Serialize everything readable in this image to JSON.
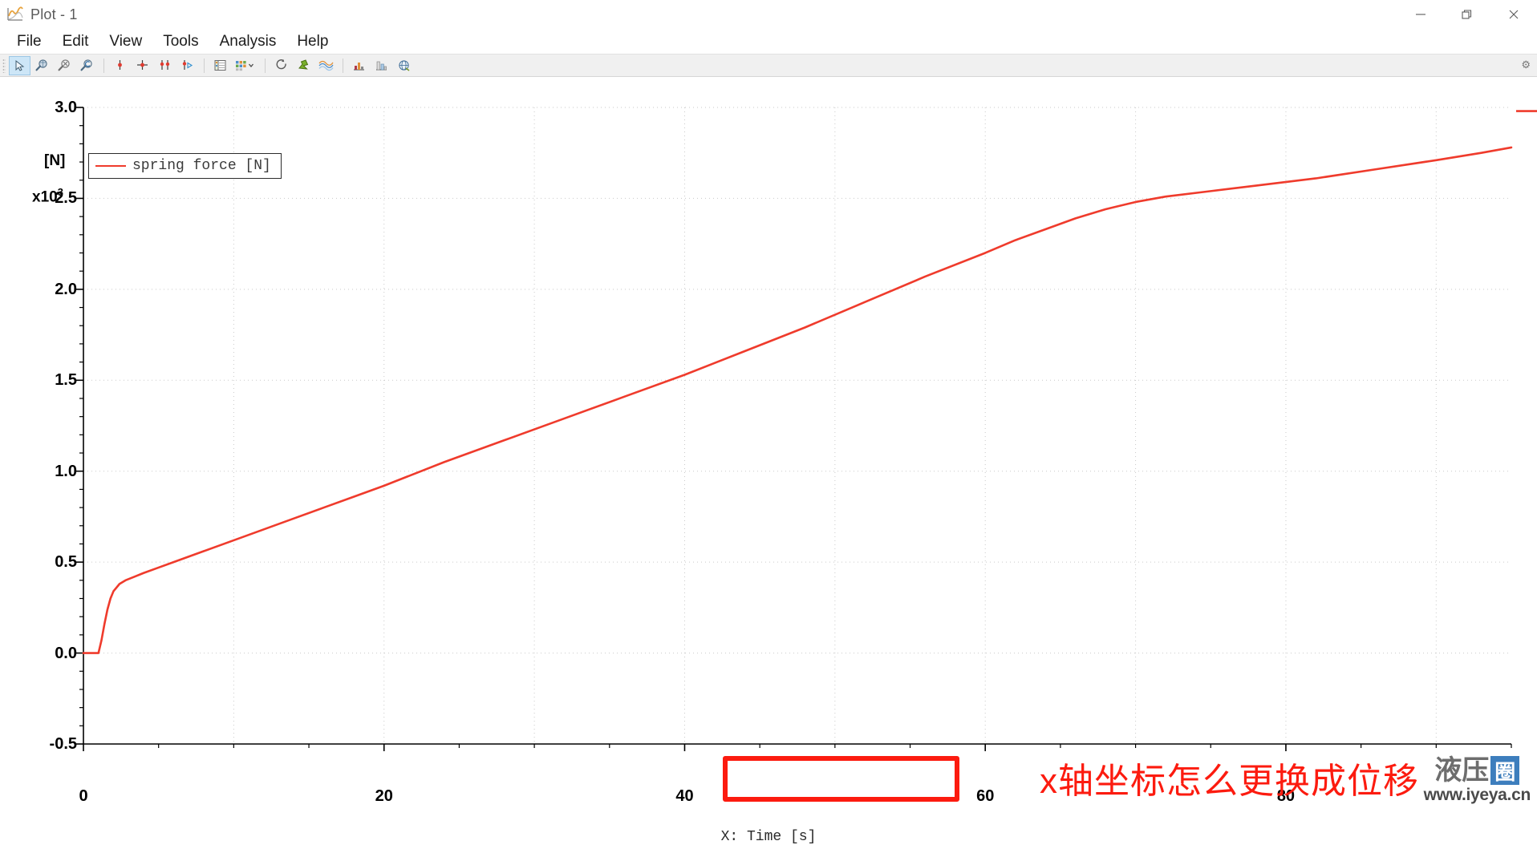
{
  "window": {
    "title": "Plot - 1",
    "app_icon": "plot-chart-icon",
    "minimize_label": "—",
    "maximize_label": "❐",
    "close_label": "✕"
  },
  "menu": {
    "items": [
      {
        "label": "File"
      },
      {
        "label": "Edit"
      },
      {
        "label": "View"
      },
      {
        "label": "Tools"
      },
      {
        "label": "Analysis"
      },
      {
        "label": "Help"
      }
    ]
  },
  "toolbar": {
    "buttons": [
      {
        "name": "select-arrow-tool",
        "icon": "cursor-arrow-icon",
        "active": true
      },
      {
        "name": "zoom-window-tool",
        "icon": "magnifier-window-icon",
        "active": false
      },
      {
        "name": "zoom-out-tool",
        "icon": "magnifier-minus-icon",
        "active": false
      },
      {
        "name": "zoom-previous-tool",
        "icon": "magnifier-undo-icon",
        "active": false
      },
      {
        "name": "single-cursor-tool",
        "icon": "pin-single-icon",
        "active": false
      },
      {
        "name": "cross-cursor-tool",
        "icon": "pin-cross-icon",
        "active": false
      },
      {
        "name": "dual-cursor-tool",
        "icon": "pin-double-icon",
        "active": false
      },
      {
        "name": "cursor-play-tool",
        "icon": "pin-play-icon",
        "active": false
      },
      {
        "name": "data-table-tool",
        "icon": "table-list-icon",
        "active": false
      },
      {
        "name": "grid-layout-tool",
        "icon": "grid-squares-icon",
        "active": false
      },
      {
        "name": "refresh-tool",
        "icon": "refresh-circle-icon",
        "active": false
      },
      {
        "name": "pin-plot-tool",
        "icon": "pushpin-star-icon",
        "active": false
      },
      {
        "name": "curves-tool",
        "icon": "wave-curves-icon",
        "active": false
      },
      {
        "name": "histogram-tool",
        "icon": "bar-chart-icon",
        "active": false
      },
      {
        "name": "statistics-tool",
        "icon": "column-chart-icon",
        "active": false
      },
      {
        "name": "export-tool",
        "icon": "globe-export-icon",
        "active": false
      }
    ],
    "overflow_icon": "chevron-down-icon",
    "right_icon": "settings-small-icon"
  },
  "annotations": {
    "red_text": "x轴坐标怎么更换成位移",
    "red_box_label": "",
    "red_color": "#fc1b0f"
  },
  "watermark": {
    "cn_text": "液压",
    "badge_text": "圈",
    "url": "www.iyeya.cn"
  },
  "chart_data": {
    "type": "line",
    "title": "",
    "xlabel": "X: Time [s]",
    "ylabel": "[N]",
    "y_multiplier": "x10",
    "y_multiplier_exponent": "3",
    "xlim": [
      0,
      95
    ],
    "ylim": [
      -0.5,
      3.0
    ],
    "x_ticks": [
      0,
      20,
      40,
      60,
      80
    ],
    "x_tick_labels": [
      "0",
      "20",
      "40",
      "60",
      "80"
    ],
    "x_minor_step": 5,
    "y_ticks": [
      -0.5,
      0.0,
      0.5,
      1.0,
      1.5,
      2.0,
      2.5,
      3.0
    ],
    "y_tick_labels": [
      "-0.5",
      "0.0",
      "0.5",
      "1.0",
      "1.5",
      "2.0",
      "2.5",
      "3.0"
    ],
    "y_minor_step": 0.1,
    "grid": true,
    "grid_style": "dotted",
    "legend_position": "top-left",
    "series": [
      {
        "name": "spring force [N]",
        "color": "#ef3b2c",
        "unit": "N",
        "x": [
          0,
          0.5,
          1.0,
          1.2,
          1.4,
          1.6,
          1.8,
          2.0,
          2.4,
          2.8,
          3.4,
          4.0,
          5.0,
          6.0,
          8.0,
          10.0,
          12.0,
          14.0,
          16.0,
          18.0,
          20.0,
          24.0,
          28.0,
          32.0,
          36.0,
          40.0,
          44.0,
          48.0,
          52.0,
          56.0,
          60.0,
          62.0,
          64.0,
          66.0,
          68.0,
          70.0,
          72.0,
          75.0,
          78.0,
          82.0,
          86.0,
          90.0,
          93.0,
          95.0
        ],
        "y": [
          0,
          0,
          0,
          0.07,
          0.16,
          0.24,
          0.3,
          0.34,
          0.38,
          0.4,
          0.42,
          0.44,
          0.47,
          0.5,
          0.56,
          0.62,
          0.68,
          0.74,
          0.8,
          0.86,
          0.92,
          1.05,
          1.17,
          1.29,
          1.41,
          1.53,
          1.66,
          1.79,
          1.93,
          2.07,
          2.2,
          2.27,
          2.33,
          2.39,
          2.44,
          2.48,
          2.51,
          2.54,
          2.57,
          2.61,
          2.66,
          2.71,
          2.75,
          2.78
        ]
      }
    ],
    "overflow_marker": {
      "visible": true,
      "description": "red line segment clipped at right edge near y=3.0"
    }
  }
}
